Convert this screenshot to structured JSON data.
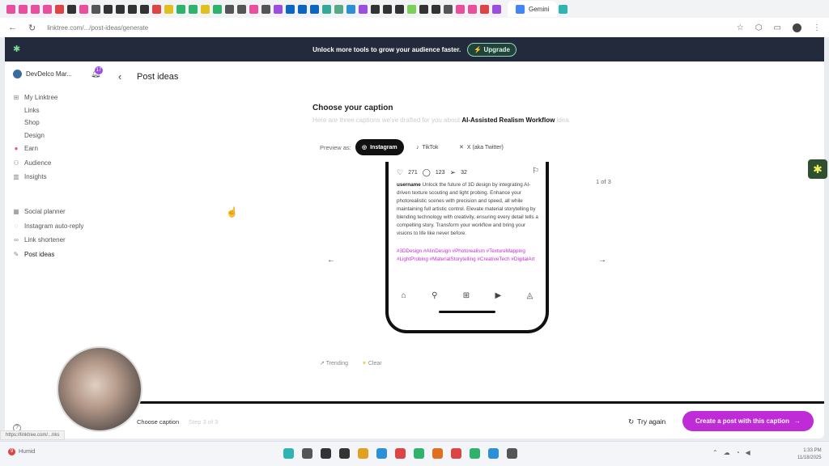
{
  "browser": {
    "tab_favicon_colors": [
      "#e94f9c",
      "#e94f9c",
      "#e94f9c",
      "#e94f9c",
      "#d44",
      "#333",
      "#e94f9c",
      "#555",
      "#333",
      "#333",
      "#333",
      "#333",
      "#d44",
      "#e0c020",
      "#2fb36c",
      "#2fb36c",
      "#e0c020",
      "#2fb36c",
      "#555",
      "#555",
      "#e94f9c",
      "#555",
      "#9b4de0",
      "#0a66c2",
      "#0a66c2",
      "#0a66c2",
      "#3a9",
      "#5a8",
      "#2d8fd6",
      "#9b4de0",
      "#333",
      "#333",
      "#333",
      "#7bd057",
      "#333",
      "#333",
      "#555",
      "#e94f9c",
      "#e94f9c",
      "#d44",
      "#9b4de0",
      "#2fb3b3"
    ],
    "active_tab_title": "Gemini",
    "url": "linktree.com/.../post-ideas/generate"
  },
  "banner": {
    "text": "Unlock more tools to grow your audience faster.",
    "upgrade_label": "Upgrade",
    "bg_color": "#222a3c"
  },
  "sidebar": {
    "profile_name": "DevDelco Mar...",
    "notification_count": "17",
    "items": [
      {
        "label": "My Linktree",
        "icon": "tree-icon"
      },
      {
        "label": "Links",
        "icon": ""
      },
      {
        "label": "Shop",
        "icon": ""
      },
      {
        "label": "Design",
        "icon": ""
      },
      {
        "label": "Earn",
        "icon": "earn-icon"
      },
      {
        "label": "Audience",
        "icon": "audience-icon"
      },
      {
        "label": "Insights",
        "icon": "insights-icon"
      },
      {
        "label": "Social planner",
        "icon": "calendar-icon"
      },
      {
        "label": "Instagram auto-reply",
        "icon": "reply-icon"
      },
      {
        "label": "Link shortener",
        "icon": "link-icon"
      },
      {
        "label": "Post ideas",
        "icon": "sparkle-icon"
      }
    ]
  },
  "page": {
    "title": "Post ideas",
    "caption_heading": "Choose your caption",
    "caption_sub_prefix": "Here are three captions we've drafted for you about",
    "caption_topic": "AI-Assisted Realism Workflow",
    "caption_sub_suffix": "idea",
    "preview_label": "Preview as:",
    "platforms": [
      "Instagram",
      "TikTok",
      "X (aka Twitter)"
    ],
    "counter": "1 of 3",
    "chips": [
      "Trending",
      "Clear"
    ]
  },
  "post": {
    "likes": "271",
    "comments": "123",
    "shares": "32",
    "username": "username",
    "caption": "Unlock the future of 3D design by integrating AI-driven texture scouting and light probing. Enhance your photorealistic scenes with precision and speed, all while maintaining full artistic control. Elevate material storytelling by blending technology with creativity, ensuring every detail tells a compelling story. Transform your workflow and bring your visions to life like never before.",
    "hashtags": "#3DDesign #AIinDesign #Photorealism #TextureMapping #LightProbing #MaterialStorytelling #CreativeTech #DigitalArt"
  },
  "footer": {
    "step_label": "Choose caption",
    "step_count": "Step 3 of 3",
    "try_again": "Try again",
    "create_label": "Create a post with this caption",
    "accent_color": "#c02bd8"
  },
  "status": {
    "url": "https://linktree.com/...nks"
  },
  "taskbar": {
    "weather_text": "Humid",
    "weather_badge": "9",
    "time": "1:33 PM",
    "date": "11/18/2025",
    "app_icon_colors": [
      "#2fb3b3",
      "#555",
      "#333",
      "#333",
      "#e0a020",
      "#2d8fd6",
      "#d44",
      "#2fb36c",
      "#e07020",
      "#d44",
      "#2fb36c",
      "#2d8fd6",
      "#555"
    ]
  }
}
